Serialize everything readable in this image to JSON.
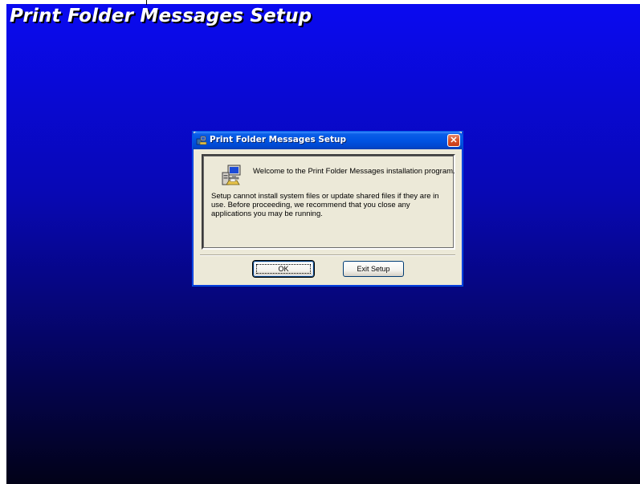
{
  "background": {
    "title": "Print Folder Messages Setup",
    "gradient_top": "#0a0af2",
    "gradient_bottom": "#020218"
  },
  "dialog": {
    "title": "Print Folder Messages Setup",
    "icon": "setup-app-icon",
    "close_icon": "close-icon",
    "close_label": "✕",
    "title_bar_color": "#0054e3",
    "close_color": "#d9542a",
    "body_color": "#ece9d8",
    "content": {
      "icon": "computer-icon",
      "welcome": "Welcome to the Print Folder Messages installation program.",
      "info": "Setup cannot install system files or update shared files if they are in use. Before proceeding, we recommend that you close any applications you may be running."
    },
    "buttons": {
      "ok_label": "OK",
      "exit_label": "Exit Setup"
    }
  }
}
